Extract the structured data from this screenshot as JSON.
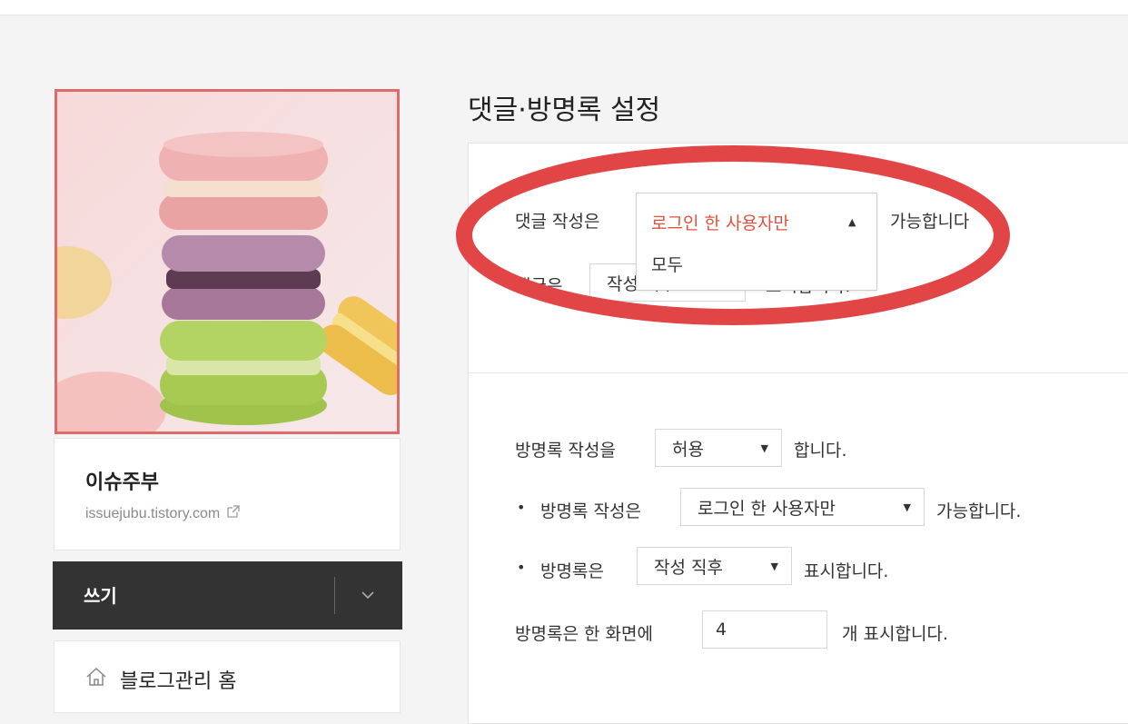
{
  "sidebar": {
    "profile_image_alt": "macarons",
    "blog_name": "이슈주부",
    "blog_url": "issuejubu.tistory.com",
    "write_label": "쓰기",
    "nav_home_label": "블로그관리 홈"
  },
  "main": {
    "title": "댓글·방명록 설정",
    "comments": {
      "write_prefix": "댓글 작성은",
      "write_suffix": "가능합니다",
      "write_dropdown": {
        "selected": "로그인 한 사용자만",
        "options": [
          "모두"
        ]
      },
      "display_prefix_partial": "댓글은",
      "display_select_partial": "작성 직후",
      "display_suffix_partial": "표시합니다."
    },
    "guestbook": {
      "allow_prefix": "방명록 작성을",
      "allow_value": "허용",
      "allow_suffix": "합니다.",
      "writer_prefix": "방명록 작성은",
      "writer_value": "로그인 한 사용자만",
      "writer_suffix": "가능합니다.",
      "display_prefix": "방명록은",
      "display_value": "작성 직후",
      "display_suffix": "표시합니다.",
      "count_prefix": "방명록은 한 화면에",
      "count_value": "4",
      "count_suffix": "개 표시합니다."
    }
  },
  "colors": {
    "accent_red": "#e0523c",
    "annotation_red": "#e24546",
    "write_bar_bg": "#333333"
  }
}
